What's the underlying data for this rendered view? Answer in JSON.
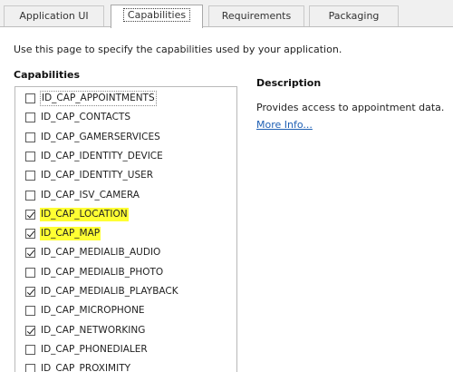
{
  "tabs": [
    {
      "label": "Application UI",
      "active": false
    },
    {
      "label": "Capabilities",
      "active": true
    },
    {
      "label": "Requirements",
      "active": false
    },
    {
      "label": "Packaging",
      "active": false
    }
  ],
  "intro_text": "Use this page to specify the capabilities used by your application.",
  "capabilities_heading": "Capabilities",
  "capabilities": [
    {
      "name": "ID_CAP_APPOINTMENTS",
      "checked": false,
      "highlighted": false,
      "selected": true
    },
    {
      "name": "ID_CAP_CONTACTS",
      "checked": false,
      "highlighted": false,
      "selected": false
    },
    {
      "name": "ID_CAP_GAMERSERVICES",
      "checked": false,
      "highlighted": false,
      "selected": false
    },
    {
      "name": "ID_CAP_IDENTITY_DEVICE",
      "checked": false,
      "highlighted": false,
      "selected": false
    },
    {
      "name": "ID_CAP_IDENTITY_USER",
      "checked": false,
      "highlighted": false,
      "selected": false
    },
    {
      "name": "ID_CAP_ISV_CAMERA",
      "checked": false,
      "highlighted": false,
      "selected": false
    },
    {
      "name": "ID_CAP_LOCATION",
      "checked": true,
      "highlighted": true,
      "selected": false
    },
    {
      "name": "ID_CAP_MAP",
      "checked": true,
      "highlighted": true,
      "selected": false
    },
    {
      "name": "ID_CAP_MEDIALIB_AUDIO",
      "checked": true,
      "highlighted": false,
      "selected": false
    },
    {
      "name": "ID_CAP_MEDIALIB_PHOTO",
      "checked": false,
      "highlighted": false,
      "selected": false
    },
    {
      "name": "ID_CAP_MEDIALIB_PLAYBACK",
      "checked": true,
      "highlighted": false,
      "selected": false
    },
    {
      "name": "ID_CAP_MICROPHONE",
      "checked": false,
      "highlighted": false,
      "selected": false
    },
    {
      "name": "ID_CAP_NETWORKING",
      "checked": true,
      "highlighted": false,
      "selected": false
    },
    {
      "name": "ID_CAP_PHONEDIALER",
      "checked": false,
      "highlighted": false,
      "selected": false
    },
    {
      "name": "ID_CAP_PROXIMITY",
      "checked": false,
      "highlighted": false,
      "selected": false
    }
  ],
  "description": {
    "heading": "Description",
    "text": "Provides access to appointment data.",
    "link_label": "More Info..."
  },
  "colors": {
    "highlight": "#ffff33",
    "link": "#1e5fb4",
    "tab_background": "#f0f0f0"
  }
}
